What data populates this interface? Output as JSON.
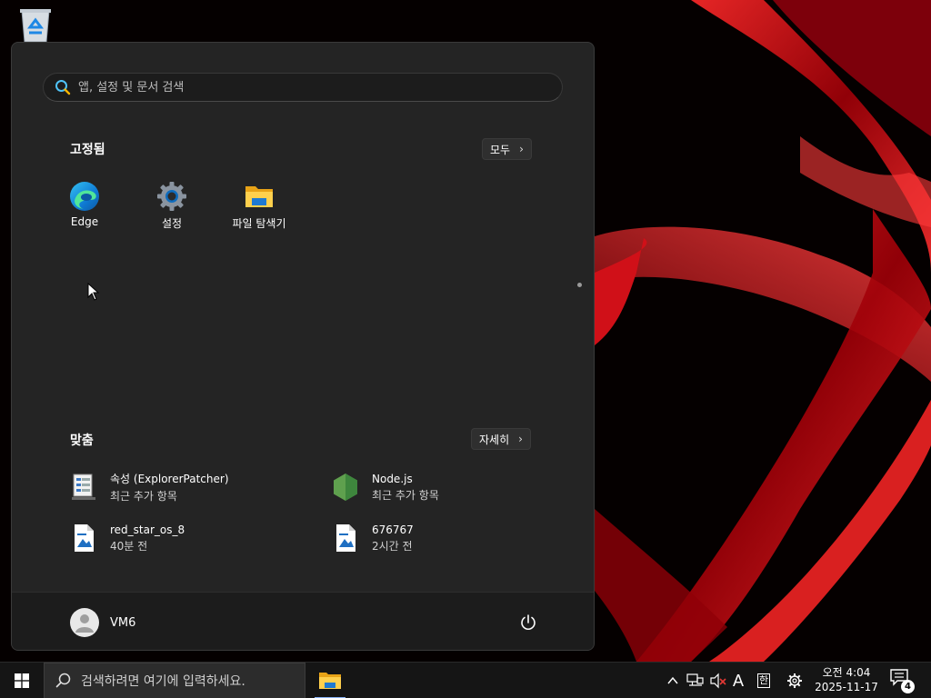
{
  "start_menu": {
    "search": {
      "placeholder": "앱, 설정 및 문서 검색"
    },
    "pinned": {
      "title": "고정됨",
      "all_button": "모두",
      "apps": [
        {
          "label": "Edge",
          "icon": "edge-icon"
        },
        {
          "label": "설정",
          "icon": "settings-gear-icon"
        },
        {
          "label": "파일 탐색기",
          "icon": "folder-icon"
        }
      ]
    },
    "recommended": {
      "title": "맞춤",
      "more_button": "자세히",
      "items": [
        {
          "name": "속성 (ExplorerPatcher)",
          "sub": "최근 추가 항목",
          "icon": "explorerpatcher-icon"
        },
        {
          "name": "Node.js",
          "sub": "최근 추가 항목",
          "icon": "nodejs-icon"
        },
        {
          "name": "red_star_os_8",
          "sub": "40분 전",
          "icon": "image-file-icon"
        },
        {
          "name": "676767",
          "sub": "2시간 전",
          "icon": "image-file-icon"
        }
      ]
    },
    "footer": {
      "user_name": "VM6"
    }
  },
  "taskbar": {
    "search_placeholder": "검색하려면 여기에 입력하세요.",
    "tray": {
      "ime_mode": "A",
      "ime_lang": "한",
      "time": "오전 4:04",
      "date": "2025-11-17",
      "notification_count": "4"
    }
  },
  "colors": {
    "menu_bg": "#242424",
    "footer_bg": "#1c1c1c",
    "taskbar_bg": "#151515",
    "accent_blue": "#0078d4",
    "wallpaper_red": "#e0141a"
  }
}
